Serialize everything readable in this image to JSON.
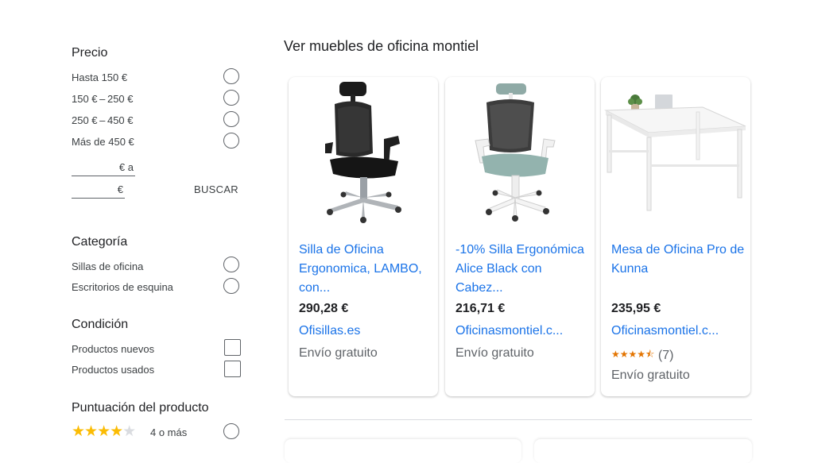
{
  "filters": {
    "price": {
      "title": "Precio",
      "options": [
        "Hasta 150 €",
        "150 € – 250 €",
        "250 € – 450 €",
        "Más de 450 €"
      ],
      "min_suffix": "€ a",
      "max_suffix": "€",
      "search_button": "BUSCAR"
    },
    "category": {
      "title": "Categoría",
      "options": [
        "Sillas de oficina",
        "Escritorios de esquina"
      ]
    },
    "condition": {
      "title": "Condición",
      "options": [
        "Productos nuevos",
        "Productos usados"
      ]
    },
    "rating": {
      "title": "Puntuación del producto",
      "stars": 4,
      "label": "4 o más"
    }
  },
  "results": {
    "heading": "Ver muebles de oficina montiel",
    "products": [
      {
        "title": "Silla de Oficina Ergonomica, LAMBO, con...",
        "price": "290,28 €",
        "seller": "Ofisillas.es",
        "shipping": "Envío gratuito",
        "image_icon": "black-mesh-office-chair"
      },
      {
        "title": "-10% Silla Ergonómica Alice Black con Cabez...",
        "price": "216,71 €",
        "seller": "Oficinasmontiel.c...",
        "shipping": "Envío gratuito",
        "image_icon": "grey-white-office-chair"
      },
      {
        "title": "Mesa de Oficina Pro de Kunna",
        "price": "235,95 €",
        "seller": "Oficinasmontiel.c...",
        "rating_count": "(7)",
        "rating_stars": 4.5,
        "shipping": "Envío gratuito",
        "image_icon": "white-office-desk"
      }
    ]
  },
  "colors": {
    "link": "#1a73e8",
    "star": "#fbbc04",
    "text": "#202124",
    "muted": "#5f6368"
  }
}
